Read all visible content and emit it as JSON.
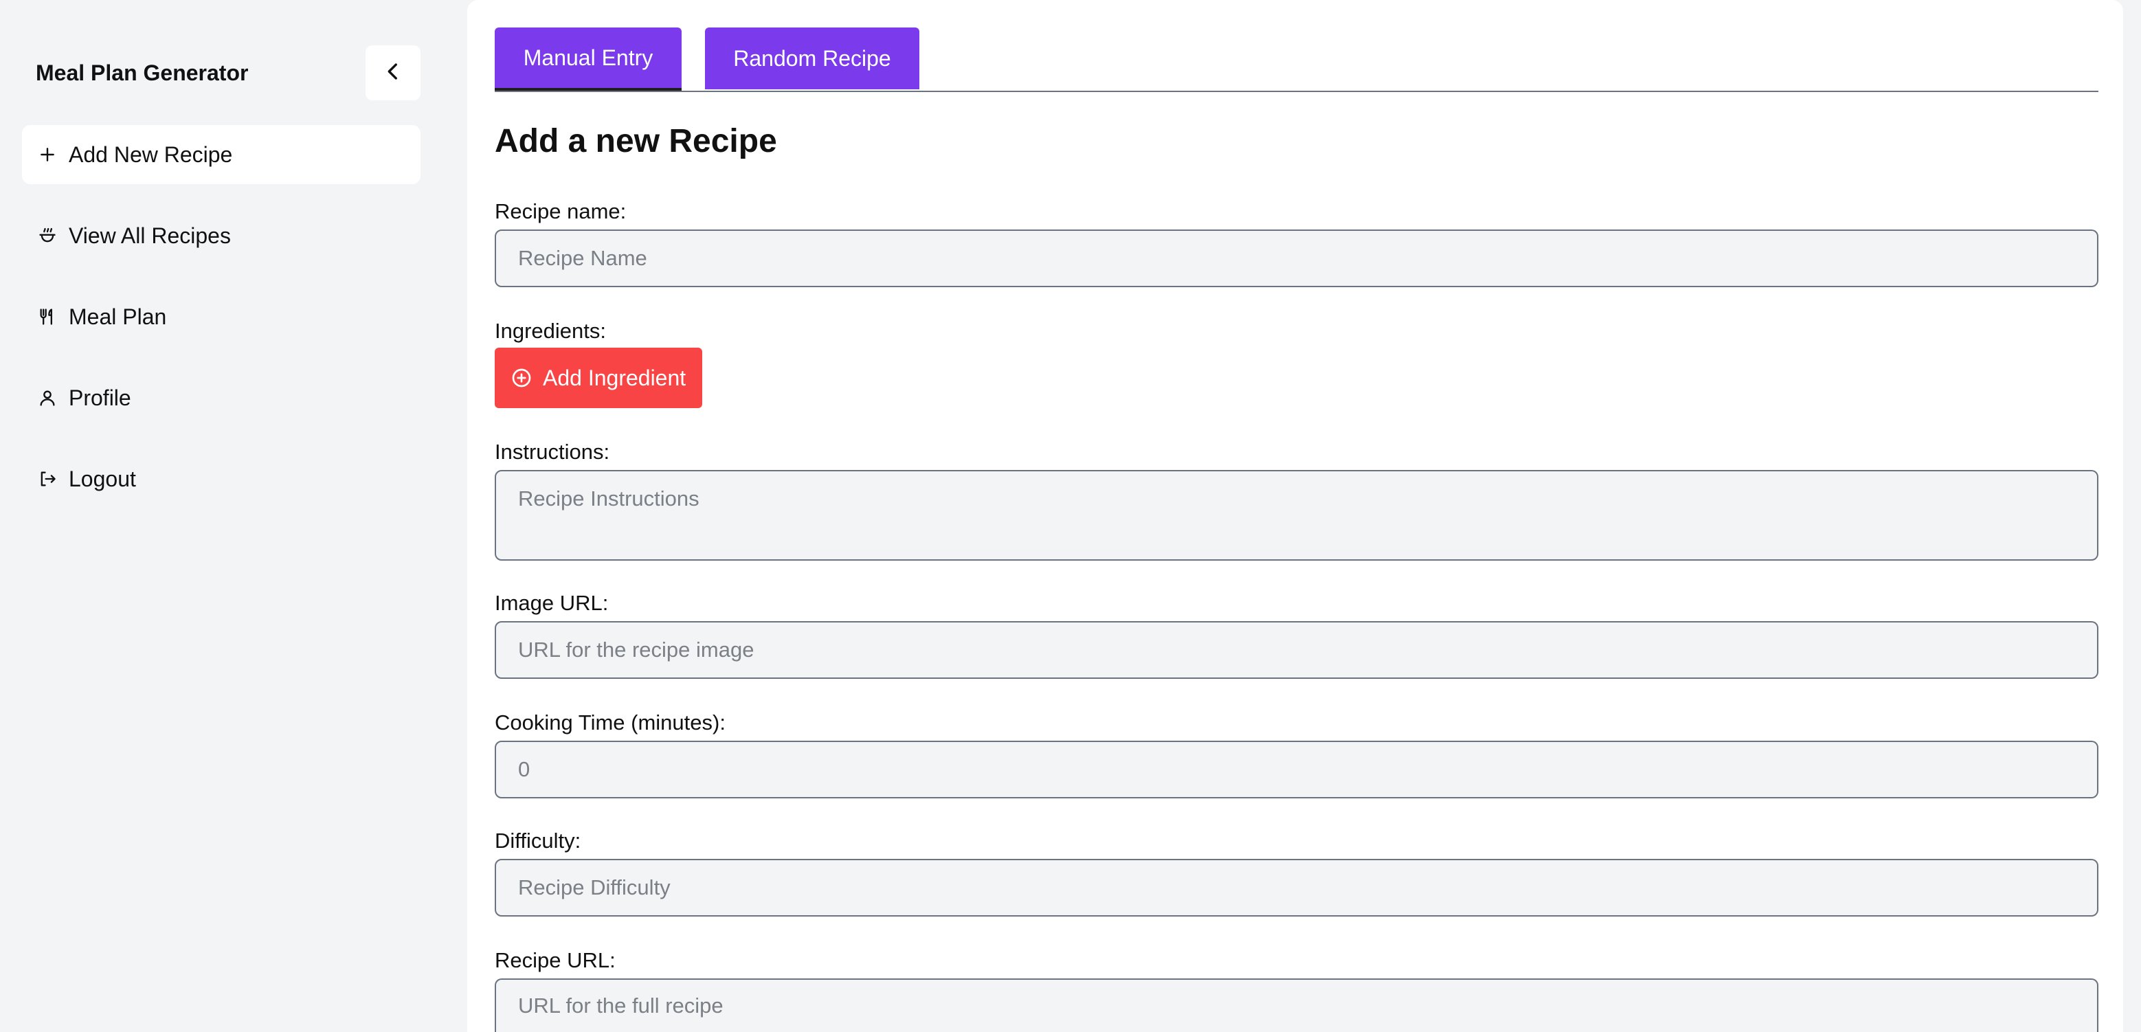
{
  "sidebar": {
    "title": "Meal Plan Generator",
    "collapse_icon": "chevron-left-icon",
    "items": [
      {
        "label": "Add New Recipe",
        "icon": "plus-icon",
        "active": true
      },
      {
        "label": "View All Recipes",
        "icon": "cooking-pot-icon",
        "active": false
      },
      {
        "label": "Meal Plan",
        "icon": "utensils-icon",
        "active": false
      },
      {
        "label": "Profile",
        "icon": "user-icon",
        "active": false
      },
      {
        "label": "Logout",
        "icon": "logout-icon",
        "active": false
      }
    ]
  },
  "tabs": [
    {
      "label": "Manual Entry",
      "active": true
    },
    {
      "label": "Random Recipe",
      "active": false
    }
  ],
  "form": {
    "title": "Add a new Recipe",
    "recipe_name": {
      "label": "Recipe name:",
      "placeholder": "Recipe Name",
      "value": ""
    },
    "ingredients": {
      "label": "Ingredients:",
      "button_label": "Add Ingredient",
      "button_icon": "plus-circle-icon"
    },
    "instructions": {
      "label": "Instructions:",
      "placeholder": "Recipe Instructions",
      "value": ""
    },
    "image_url": {
      "label": "Image URL:",
      "placeholder": "URL for the recipe image",
      "value": ""
    },
    "cooking_time": {
      "label": "Cooking Time (minutes):",
      "placeholder": "0",
      "value": ""
    },
    "difficulty": {
      "label": "Difficulty:",
      "placeholder": "Recipe Difficulty",
      "value": ""
    },
    "recipe_url": {
      "label": "Recipe URL:",
      "placeholder": "URL for the full recipe",
      "value": ""
    }
  },
  "colors": {
    "accent": "#7c3aed",
    "danger": "#f84444",
    "background": "#f3f4f6",
    "panel": "#ffffff"
  }
}
